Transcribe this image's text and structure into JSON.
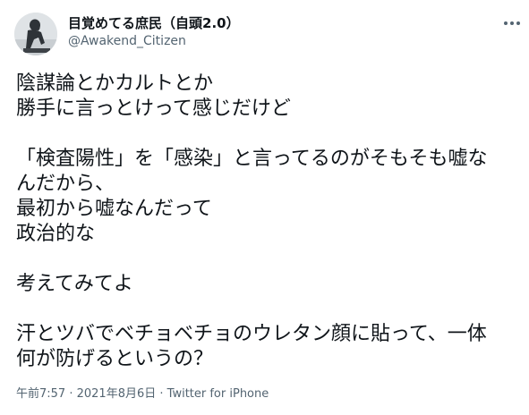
{
  "author": {
    "display_name": "目覚めてる庶民（自頭2.0）",
    "handle": "@Awakend_Citizen",
    "avatar_icon": "thinker-statue-avatar"
  },
  "tweet": {
    "lines": [
      "陰謀論とかカルトとか",
      "勝手に言っとけって感じだけど",
      "",
      "「検査陽性」を「感染」と言ってるのがそもそも嘘な",
      "んだから、",
      "最初から嘘なんだって",
      "政治的な",
      "",
      "考えてみてよ",
      "",
      "汗とツバでベチョベチョのウレタン顔に貼って、一体",
      "何が防げるというの？"
    ]
  },
  "meta": {
    "time": "午前7:57",
    "separator1": " · ",
    "date": "2021年8月6日",
    "separator2": " · ",
    "source": "Twitter for iPhone"
  },
  "colors": {
    "text": "#0f1419",
    "secondary": "#536471",
    "background": "#ffffff"
  }
}
